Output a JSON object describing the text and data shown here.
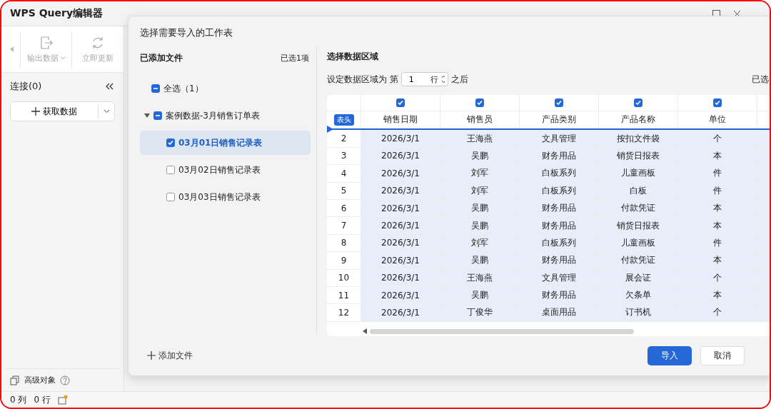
{
  "app": {
    "title": "WPS Query编辑器"
  },
  "toolbar": [
    {
      "label": "输出数据",
      "kind": "dropdown",
      "disabled": true
    },
    {
      "label": "立即更新",
      "kind": "button",
      "disabled": true
    }
  ],
  "sidebar": {
    "heading": "连接(0)",
    "get_data_button": "获取数据",
    "advanced": "高级对象"
  },
  "status_bar": {
    "columns": "0 列",
    "rows": "0 行"
  },
  "dialog": {
    "title": "选择需要导入的工作表",
    "files_panel": {
      "heading": "已添加文件",
      "count": "已选1项",
      "select_all": {
        "label": "全选（1）",
        "indeterminate": true
      },
      "tree": [
        {
          "label": "案例数据-3月销售订单表",
          "indeterminate": true,
          "expanded": true,
          "children": [
            {
              "label": "03月01日销售记录表",
              "checked": true,
              "selected": true
            },
            {
              "label": "03月02日销售记录表",
              "checked": false,
              "selected": false
            },
            {
              "label": "03月03日销售记录表",
              "checked": false,
              "selected": false
            }
          ]
        }
      ],
      "add_file": "添加文件"
    },
    "range_panel": {
      "heading": "选择数据区域",
      "prefix": "设定数据区域为 第",
      "start_row": "1",
      "unit": "行",
      "suffix": "之后",
      "selected_info": "已选",
      "table": {
        "header_badge": "表头",
        "columns": [
          {
            "label": "销售日期",
            "checked": true
          },
          {
            "label": "销售员",
            "checked": true
          },
          {
            "label": "产品类别",
            "checked": true
          },
          {
            "label": "产品名称",
            "checked": true
          },
          {
            "label": "单位",
            "checked": true
          }
        ],
        "rows": [
          {
            "number": "2",
            "cells": [
              "2026/3/1",
              "王海燕",
              "文具管理",
              "按扣文件袋",
              "个"
            ]
          },
          {
            "number": "3",
            "cells": [
              "2026/3/1",
              "吴鹏",
              "财务用品",
              "销货日报表",
              "本"
            ]
          },
          {
            "number": "4",
            "cells": [
              "2026/3/1",
              "刘军",
              "白板系列",
              "儿童画板",
              "件"
            ]
          },
          {
            "number": "5",
            "cells": [
              "2026/3/1",
              "刘军",
              "白板系列",
              "白板",
              "件"
            ]
          },
          {
            "number": "6",
            "cells": [
              "2026/3/1",
              "吴鹏",
              "财务用品",
              "付款凭证",
              "本"
            ]
          },
          {
            "number": "7",
            "cells": [
              "2026/3/1",
              "吴鹏",
              "财务用品",
              "销货日报表",
              "本"
            ]
          },
          {
            "number": "8",
            "cells": [
              "2026/3/1",
              "刘军",
              "白板系列",
              "儿童画板",
              "件"
            ]
          },
          {
            "number": "9",
            "cells": [
              "2026/3/1",
              "吴鹏",
              "财务用品",
              "付款凭证",
              "本"
            ]
          },
          {
            "number": "10",
            "cells": [
              "2026/3/1",
              "王海燕",
              "文具管理",
              "展会证",
              "个"
            ]
          },
          {
            "number": "11",
            "cells": [
              "2026/3/1",
              "吴鹏",
              "财务用品",
              "欠条单",
              "本"
            ]
          },
          {
            "number": "12",
            "cells": [
              "2026/3/1",
              "丁俊华",
              "桌面用品",
              "订书机",
              "个"
            ]
          }
        ]
      }
    },
    "buttons": [
      {
        "label": "导入",
        "kind": "primary"
      },
      {
        "label": "取消",
        "kind": "secondary"
      }
    ]
  }
}
